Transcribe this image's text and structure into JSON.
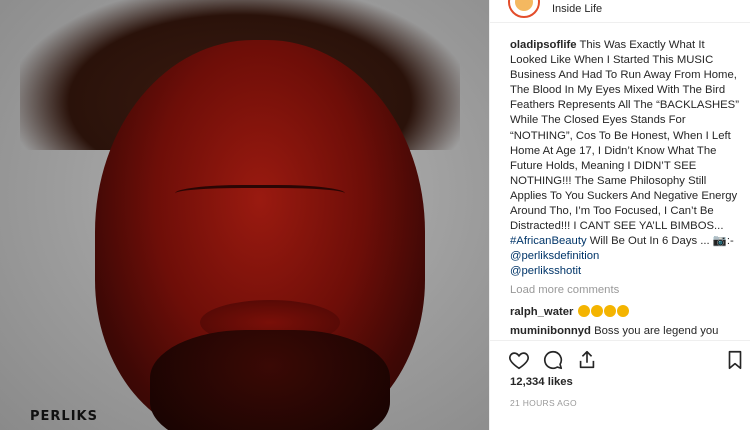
{
  "post": {
    "location": "Inside Life",
    "watermark": "PERLIKS",
    "caption": {
      "username": "oladipsoflife",
      "text": " This Was Exactly What It Looked Like When I Started This MUSIC Business And Had To Run Away From Home, The Blood In My Eyes Mixed With The Bird Feathers Represents All The “BACKLASHES” While The Closed Eyes Stands For “NOTHING”, Cos To Be Honest, When I Left Home At Age 17, I Didn’t Know What The Future Holds, Meaning I DIDN’T SEE NOTHING!!! The Same Philosophy Still Applies To You Suckers And Negative Energy Around Tho, I’m Too Focused, I Can’t Be Distracted!!! I CANT SEE YA’LL BIMBOS... ",
      "hashtag": "#AfricanBeauty",
      "text2": " Will Be Out In 6 Days ... 📷:- ",
      "mention1": "@perliksdefinition",
      "mention2": "@perliksshotit"
    },
    "load_more": "Load more comments",
    "comments": [
      {
        "username": "ralph_water",
        "text": ""
      },
      {
        "username": "muminibonnyd",
        "text": " Boss you are legend you"
      }
    ],
    "likes": "12,334 likes",
    "timestamp": "21 HOURS AGO"
  },
  "icons": [
    "heart-icon",
    "comment-icon",
    "share-icon",
    "bookmark-icon"
  ]
}
